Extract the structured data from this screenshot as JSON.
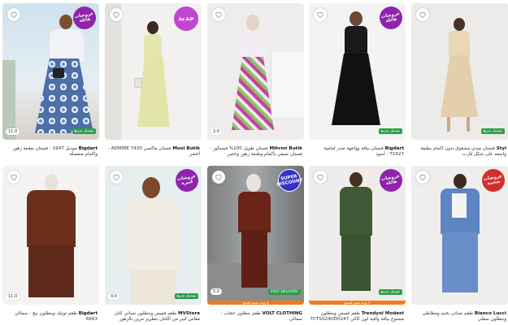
{
  "products": [
    {
      "brand": "Bigdart",
      "title": "مودبل 1947 - فستان بطبعة زهور وأكمام منفصلة",
      "badge": "عروضات هائلة",
      "rating": "11.0",
      "shipping": "توصيل سريع"
    },
    {
      "brand": "Mooi Butik",
      "title": "فستان ماكسي ADMIRE 7430 - أخضر",
      "badge": "جديد",
      "rating": "",
      "shipping": ""
    },
    {
      "brand": "Mihron Butik",
      "title": "فستان طويل 100% فيسكوز - فستان صيفي بأكمام وطبعة زهور وخصر",
      "badge": "",
      "rating": "2.0",
      "shipping": ""
    },
    {
      "brand": "Bigdart",
      "title": "فستان بياقة وواجهة صدر أمامية T1627 - أسود",
      "badge": "عروضات هائلة",
      "rating": "",
      "shipping": "توصيل سريع"
    },
    {
      "brand": "Styl",
      "title": "فستان ميدي مشقوق بدون أكمام بطبقة واسعة على شكل قارب",
      "badge": "",
      "rating": "",
      "shipping": "توصيل سريع"
    },
    {
      "brand": "Bigdart",
      "title": "طقم تونيك وبنطلون بيج - سمالي 6663",
      "badge": "",
      "rating": "11.0",
      "shipping": ""
    },
    {
      "brand": "MVStore",
      "title": "طقم قميص وبنطلون نسائي كتان مقاس كبير من الكتان بتطريز مزين بالزهور والتفاصيل الحجرية",
      "badge": "عروضات كبيرة",
      "rating": "4.0",
      "shipping": "توصيل سريع"
    },
    {
      "brand": "VOLT CLOTHING",
      "title": "طقم بنطلون حجاب - سمالي",
      "badge": "SUPER DISCOUNT",
      "rating": "5.0",
      "shipping": "FAST DELIVERY",
      "strip": "لا يوجد تقييم للمنتج"
    },
    {
      "brand": "Trendyol Modest",
      "title": "طقم قميص وبنطلون منسوج بياقة واقية لون كاكي TCTSS24UD0247",
      "badge": "عروضات هائلة",
      "rating": "",
      "shipping": "توصيل سريع",
      "strip": "لا يوجد تقييم للمنتج"
    },
    {
      "brand": "Bianco Lucci",
      "title": "طقم نسائي بجيم ومطاطي وبنطلون سفلي",
      "badge": "عروضات ضخمة",
      "rating": "",
      "shipping": ""
    }
  ]
}
